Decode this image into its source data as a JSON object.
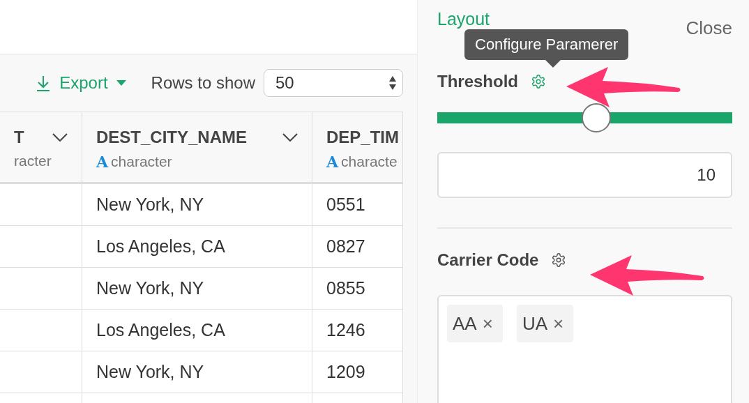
{
  "toolbar": {
    "export_label": "Export",
    "rows_label": "Rows to show",
    "rows_value": "50"
  },
  "table": {
    "columns": [
      {
        "name": "T",
        "type": "racter"
      },
      {
        "name": "DEST_CITY_NAME",
        "type": "character",
        "type_badge": "A"
      },
      {
        "name": "DEP_TIM",
        "type": "characte",
        "type_badge": "A"
      }
    ],
    "rows": [
      [
        "",
        "New York, NY",
        "0551"
      ],
      [
        "",
        "Los Angeles, CA",
        "0827"
      ],
      [
        "",
        "New York, NY",
        "0855"
      ],
      [
        "",
        "Los Angeles, CA",
        "1246"
      ],
      [
        "",
        "New York, NY",
        "1209"
      ],
      [
        "",
        "",
        ""
      ]
    ]
  },
  "panel": {
    "title": "Layout",
    "close": "Close",
    "tooltip": "Configure Paramerer",
    "parameters": [
      {
        "kind": "slider",
        "label": "Threshold",
        "gear_active": true,
        "level": 0.54,
        "value": "10"
      },
      {
        "kind": "select",
        "label": "Carrier Code",
        "gear_active": false,
        "tags": [
          {
            "label": "AA",
            "remove": "×"
          },
          {
            "label": "UA",
            "remove": "×"
          }
        ]
      }
    ]
  }
}
